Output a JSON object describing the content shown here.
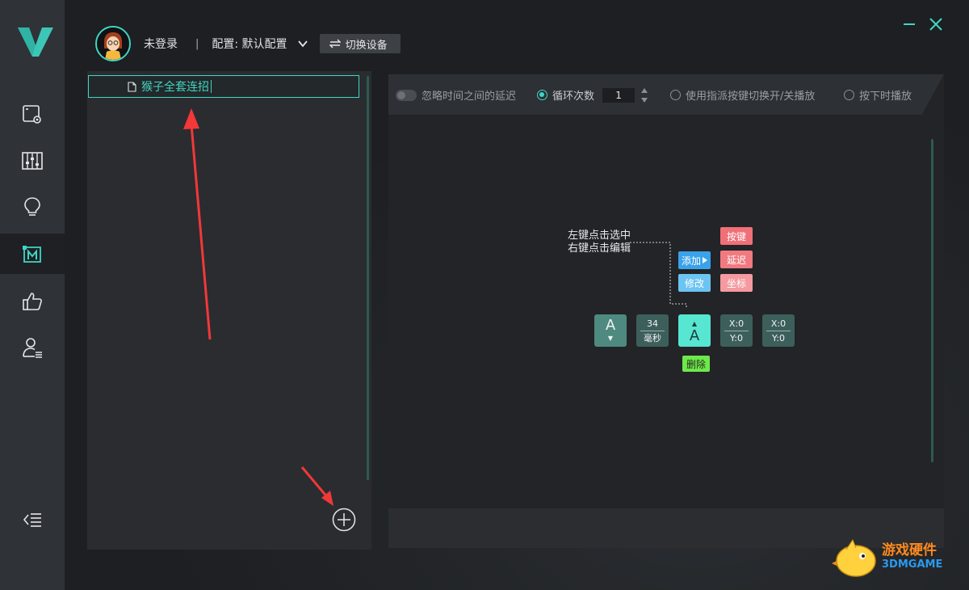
{
  "app": {
    "name": "V"
  },
  "header": {
    "user_label": "未登录",
    "separator": "|",
    "config_label": "配置: 默认配置",
    "switch_device_label": "切换设备"
  },
  "sidebar": {
    "items": [
      {
        "icon": "device-settings-icon"
      },
      {
        "icon": "equalizer-icon"
      },
      {
        "icon": "lightbulb-icon"
      },
      {
        "icon": "macro-icon",
        "active": true
      },
      {
        "icon": "thumbs-up-icon"
      },
      {
        "icon": "user-list-icon"
      }
    ],
    "collapse_icon": "collapse-menu-icon"
  },
  "macro_list": {
    "items": [
      {
        "label": "猴子全套连招",
        "selected": true
      }
    ]
  },
  "options": {
    "ignore_delay_label": "忽略时间之间的延迟",
    "loop_label": "循环次数",
    "loop_value": "1",
    "toggle_play_label": "使用指派按键切换开/关播放",
    "hold_play_label": "按下时播放"
  },
  "editor": {
    "hint_line1": "左键点击选中",
    "hint_line2": "右键点击编辑",
    "add_button": "添加",
    "modify_button": "修改",
    "key_button": "按键",
    "delay_button": "延迟",
    "coord_button": "坐标",
    "delete_button": "删除",
    "tiles": [
      {
        "type": "key",
        "label": "A",
        "arrow": "▼"
      },
      {
        "type": "delay",
        "value": "34",
        "unit": "毫秒"
      },
      {
        "type": "key-selected",
        "label": "A",
        "arrow": "▲"
      },
      {
        "type": "coord",
        "x": "X:0",
        "y": "Y:0"
      },
      {
        "type": "coord",
        "x": "X:0",
        "y": "Y:0"
      }
    ]
  },
  "watermark": {
    "line1": "游戏硬件",
    "line2": "3DMGAME"
  },
  "colors": {
    "accent": "#3fd6c4",
    "sidebar_bg": "#2f3237",
    "panel_bg": "#2a2c30"
  }
}
